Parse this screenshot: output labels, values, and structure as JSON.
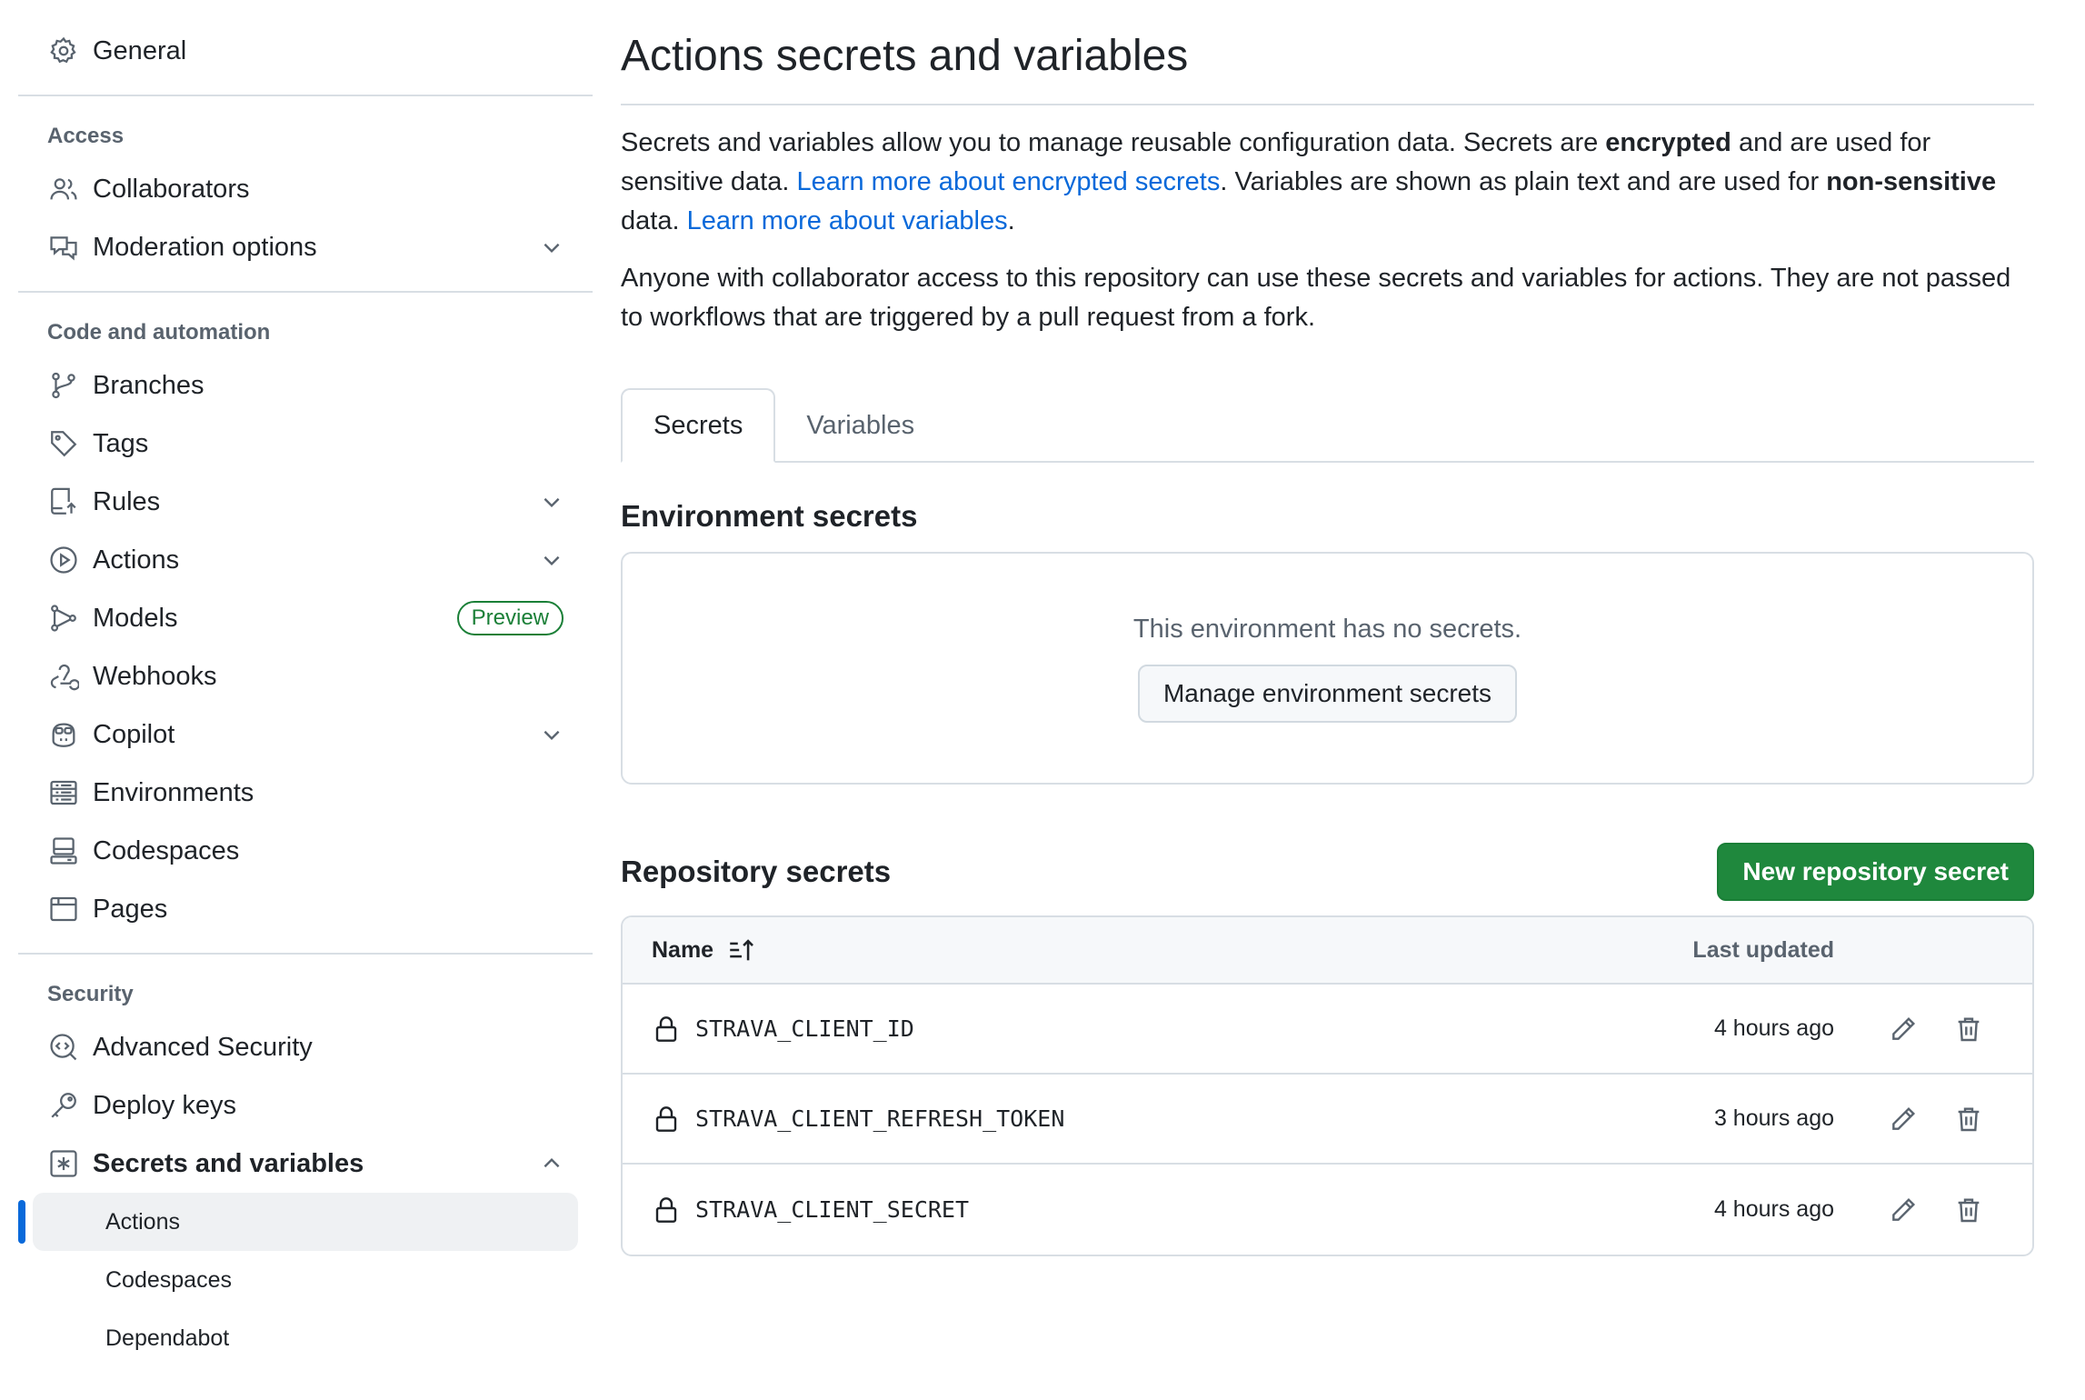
{
  "sidebar": {
    "general": "General",
    "groups": {
      "access": "Access",
      "code": "Code and automation",
      "security": "Security"
    },
    "items": {
      "collaborators": "Collaborators",
      "moderation": "Moderation options",
      "branches": "Branches",
      "tags": "Tags",
      "rules": "Rules",
      "actions": "Actions",
      "models": "Models",
      "models_badge": "Preview",
      "webhooks": "Webhooks",
      "copilot": "Copilot",
      "environments": "Environments",
      "codespaces": "Codespaces",
      "pages": "Pages",
      "advanced_security": "Advanced Security",
      "deploy_keys": "Deploy keys",
      "secrets_variables": "Secrets and variables"
    },
    "sub_items": {
      "actions": "Actions",
      "codespaces": "Codespaces",
      "dependabot": "Dependabot"
    }
  },
  "main": {
    "title": "Actions secrets and variables",
    "para1": {
      "t1": "Secrets and variables allow you to manage reusable configuration data. Secrets are ",
      "b1": "encrypted",
      "t2": " and are used for sensitive data. ",
      "link1": "Learn more about encrypted secrets",
      "t3": ". Variables are shown as plain text and are used for ",
      "b2": "non-sensitive",
      "t4": " data. ",
      "link2": "Learn more about variables",
      "t5": "."
    },
    "para2": "Anyone with collaborator access to this repository can use these secrets and variables for actions. They are not passed to workflows that are triggered by a pull request from a fork.",
    "tabs": [
      "Secrets",
      "Variables"
    ],
    "env_section": {
      "title": "Environment secrets",
      "empty_text": "This environment has no secrets.",
      "button": "Manage environment secrets"
    },
    "repo_section": {
      "title": "Repository secrets",
      "button": "New repository secret",
      "col_name": "Name",
      "col_updated": "Last updated",
      "rows": [
        {
          "name": "STRAVA_CLIENT_ID",
          "updated": "4 hours ago"
        },
        {
          "name": "STRAVA_CLIENT_REFRESH_TOKEN",
          "updated": "3 hours ago"
        },
        {
          "name": "STRAVA_CLIENT_SECRET",
          "updated": "4 hours ago"
        }
      ]
    }
  },
  "colors": {
    "accent": "#0969da",
    "primary_button": "#1f883d",
    "preview_badge": "#1a7f37",
    "muted_text": "#59636e"
  }
}
